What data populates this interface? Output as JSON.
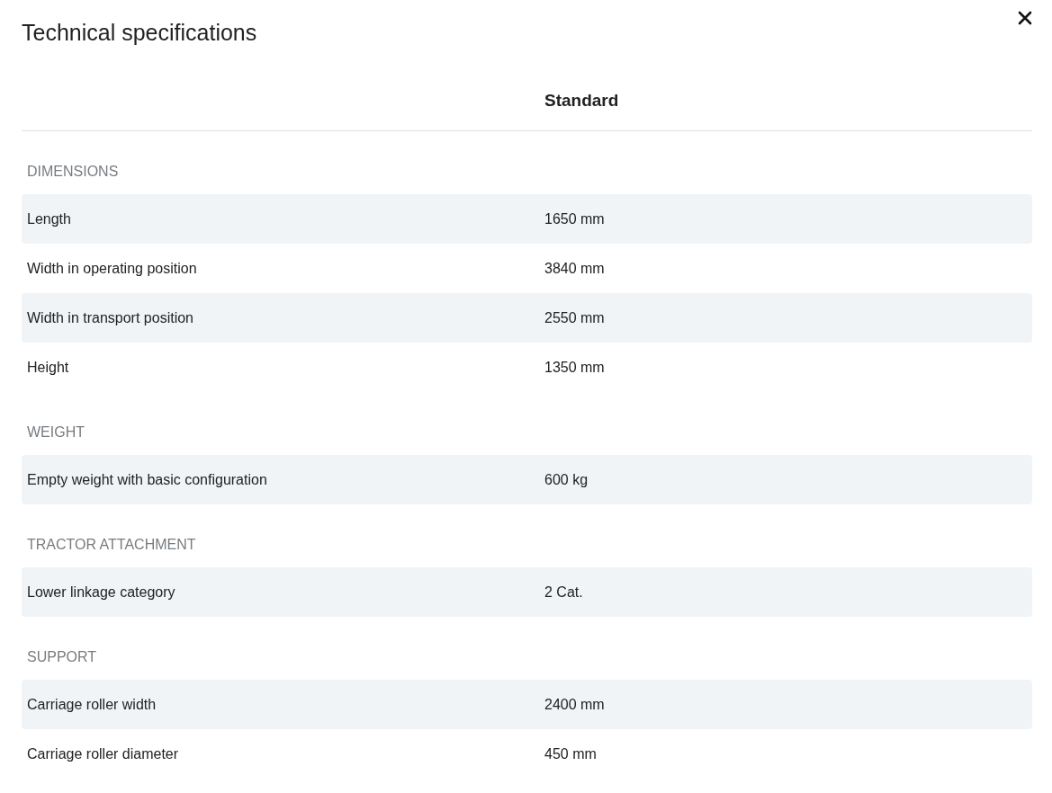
{
  "dialog": {
    "title": "Technical specifications"
  },
  "table": {
    "column_header": "Standard",
    "sections": [
      {
        "title": "DIMENSIONS",
        "rows": [
          {
            "label": "Length",
            "value": "1650 mm"
          },
          {
            "label": "Width in operating position",
            "value": "3840 mm"
          },
          {
            "label": "Width in transport position",
            "value": "2550 mm"
          },
          {
            "label": "Height",
            "value": "1350 mm"
          }
        ]
      },
      {
        "title": "WEIGHT",
        "rows": [
          {
            "label": "Empty weight with basic configuration",
            "value": "600 kg"
          }
        ]
      },
      {
        "title": "TRACTOR ATTACHMENT",
        "rows": [
          {
            "label": "Lower linkage category",
            "value": "2 Cat."
          }
        ]
      },
      {
        "title": "SUPPORT",
        "rows": [
          {
            "label": "Carriage roller width",
            "value": "2400 mm"
          },
          {
            "label": "Carriage roller diameter",
            "value": "450 mm"
          }
        ]
      }
    ]
  }
}
